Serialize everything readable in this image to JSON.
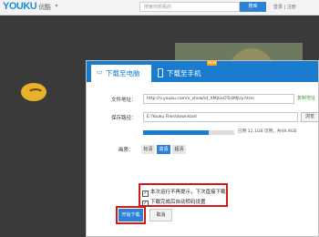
{
  "header": {
    "logo_text": "YOUKU",
    "logo_cn": "优酷",
    "search_placeholder": "搜索你想看的",
    "search_button": "搜库",
    "links": "登录 | 注册"
  },
  "dialog": {
    "tabs": [
      {
        "label": "下载至电脑",
        "icon": "pc-icon",
        "active": true
      },
      {
        "label": "下载至手机",
        "icon": "phone-icon",
        "badge": "NEW"
      }
    ],
    "url_label": "文件地址：",
    "url_value": "http://v.youku.com/v_show/id_XMjUxOTc4MjUy.html",
    "copy_link": "复制地址",
    "save_label": "保存路径：",
    "save_value": "E:\\Youku Files\\download",
    "browse_label": "浏览",
    "disk_used_fraction": 0.72,
    "disk_text": "已用 12.1GB 可用，共49.9GB",
    "quality_label": "画质：",
    "quality_options": [
      "标清",
      "高清",
      "超清"
    ],
    "quality_selected": "高清",
    "option1": "本次运行不再提示，下次直接下载",
    "option2": "下载完成后自动转码设置",
    "start_button": "开始下载",
    "cancel_button": "取消"
  },
  "colors": {
    "accent": "#1a7ccf",
    "highlight": "#d21a1a"
  }
}
